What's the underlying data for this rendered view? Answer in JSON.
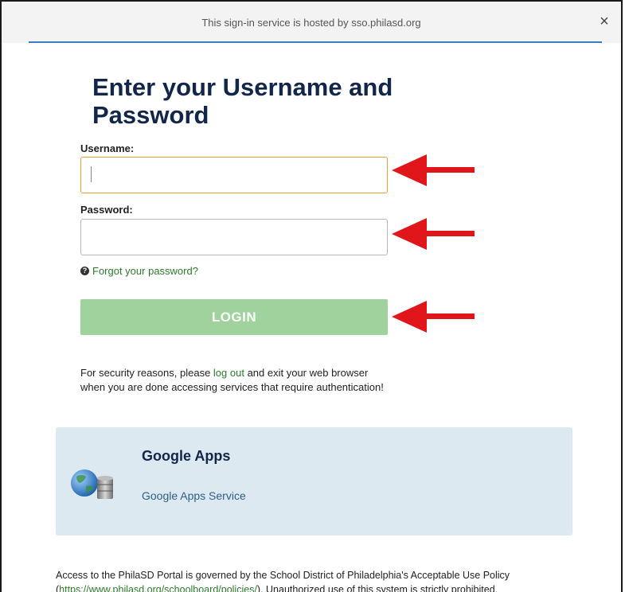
{
  "header": {
    "hosted_text": "This sign-in service is hosted by sso.philasd.org",
    "close_label": "×"
  },
  "form": {
    "title": "Enter your Username and Password",
    "username_label": "Username:",
    "username_value": "",
    "password_label": "Password:",
    "password_value": "",
    "forgot_label": "Forgot your password?",
    "login_label": "LOGIN"
  },
  "security_notice": {
    "before": "For security reasons, please ",
    "link": "log out",
    "after": " and exit your web browser when you are done accessing services that require authentication!"
  },
  "apps": {
    "title": "Google Apps",
    "service_link": "Google Apps Service"
  },
  "footer": {
    "text_before": "Access to the PhilaSD Portal is governed by the School District of Philadelphia's Acceptable Use Policy (",
    "policy_link": "https://www.philasd.org/schoolboard/policies/",
    "text_after": "). Unauthorized use of this system is strictly prohibited."
  },
  "colors": {
    "accent_line": "#3a7cc4",
    "title": "#12264a",
    "login_button": "#9fd29c",
    "link_green": "#2e7a2e",
    "apps_panel": "#dce9f1",
    "annotation_arrow": "#e0161b",
    "focus_border": "#e0a33a"
  },
  "icons": {
    "close": "close-icon",
    "help": "help-circle-icon",
    "apps": "globe-database-icon",
    "annotation": "red-arrow-left-icon"
  }
}
